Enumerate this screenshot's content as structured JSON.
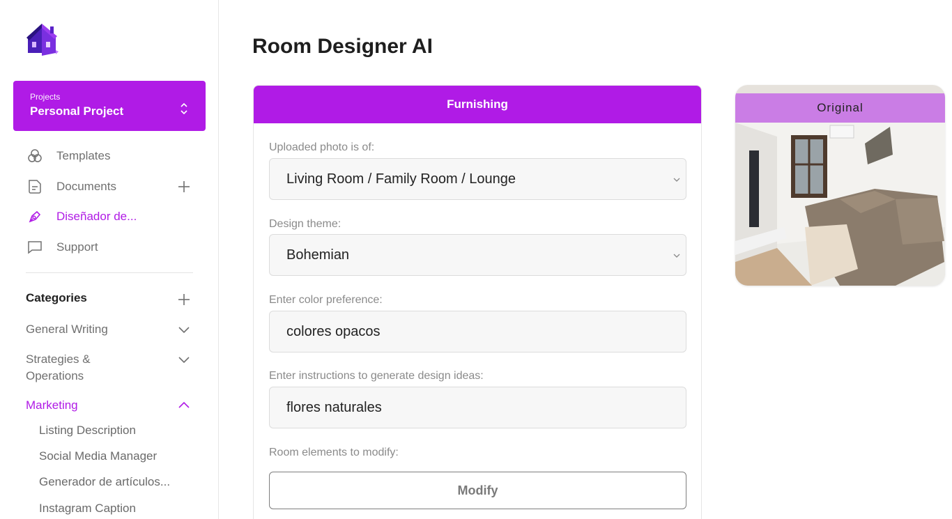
{
  "sidebar": {
    "project": {
      "label": "Projects",
      "name": "Personal Project"
    },
    "nav": [
      {
        "label": "Templates",
        "icon": "templates-icon"
      },
      {
        "label": "Documents",
        "icon": "document-icon"
      },
      {
        "label": "Diseñador de...",
        "icon": "design-icon"
      },
      {
        "label": "Support",
        "icon": "chat-icon"
      }
    ],
    "categories_title": "Categories",
    "categories": [
      {
        "label": "General Writing"
      },
      {
        "label": "Strategies & Operations"
      },
      {
        "label": "Marketing"
      }
    ],
    "marketing_items": [
      "Listing Description",
      "Social Media Manager",
      "Generador de artículos...",
      "Instagram Caption"
    ]
  },
  "main": {
    "title": "Room Designer AI",
    "panel_header": "Furnishing",
    "fields": {
      "photo_label": "Uploaded photo is of:",
      "photo_value": "Living Room / Family Room / Lounge",
      "theme_label": "Design theme:",
      "theme_value": "Bohemian",
      "color_label": "Enter color preference:",
      "color_value": "colores opacos",
      "instructions_label": "Enter instructions to generate design ideas:",
      "instructions_value": "flores naturales",
      "elements_label": "Room elements to modify:",
      "modify_button": "Modify"
    },
    "original_label": "Original"
  },
  "colors": {
    "accent": "#b01be6",
    "text_muted": "#707070"
  }
}
